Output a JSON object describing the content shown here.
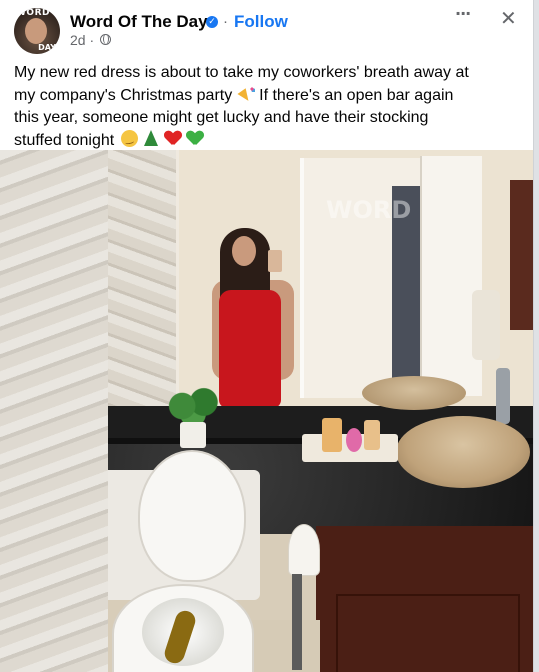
{
  "post": {
    "page_name": "Word Of The Day",
    "verified_glyph": "✓",
    "separator": "·",
    "follow_label": "Follow",
    "timestamp": "2d ·",
    "more_glyph": "···",
    "close_glyph": "✕",
    "avatar_text_top": "WORD",
    "avatar_text_bottom": "DAY",
    "caption_lines": [
      "My new red dress is about to take my coworkers' breath away at",
      "my company's Christmas party",
      "If there's an open bar again",
      "this year, someone might get lucky and have their stocking",
      "stuffed tonight"
    ],
    "caption_icons": [
      "party-popper-icon",
      "smirk-face-icon",
      "christmas-tree-icon",
      "red-heart-icon",
      "green-heart-icon"
    ]
  },
  "photo": {
    "watermark": "WORD",
    "description_colors": {
      "dress": "#c8161d",
      "countertop": "#1f1f1f",
      "vanity": "#4b1f15",
      "sink": "#c9b08a"
    }
  },
  "colors": {
    "link": "#1877f2",
    "text": "#050505",
    "secondary": "#65676b"
  }
}
